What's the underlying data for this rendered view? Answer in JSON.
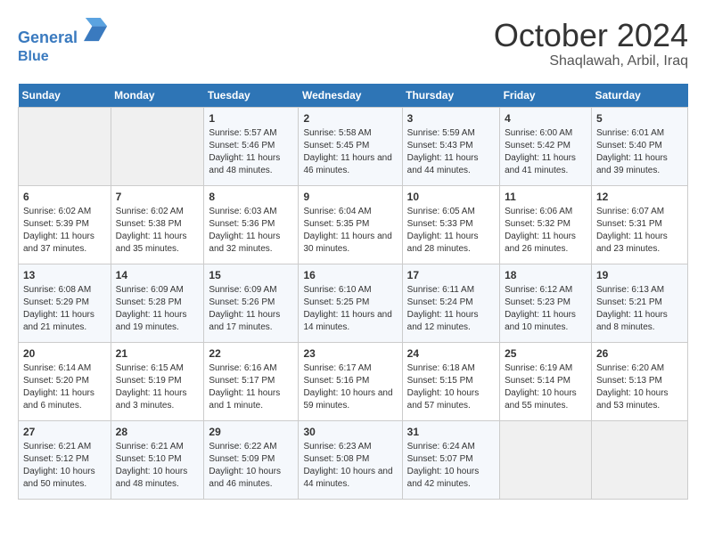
{
  "logo": {
    "line1": "General",
    "line2": "Blue"
  },
  "title": "October 2024",
  "location": "Shaqlawah, Arbil, Iraq",
  "weekdays": [
    "Sunday",
    "Monday",
    "Tuesday",
    "Wednesday",
    "Thursday",
    "Friday",
    "Saturday"
  ],
  "weeks": [
    [
      {
        "day": "",
        "info": ""
      },
      {
        "day": "",
        "info": ""
      },
      {
        "day": "1",
        "info": "Sunrise: 5:57 AM\nSunset: 5:46 PM\nDaylight: 11 hours and 48 minutes."
      },
      {
        "day": "2",
        "info": "Sunrise: 5:58 AM\nSunset: 5:45 PM\nDaylight: 11 hours and 46 minutes."
      },
      {
        "day": "3",
        "info": "Sunrise: 5:59 AM\nSunset: 5:43 PM\nDaylight: 11 hours and 44 minutes."
      },
      {
        "day": "4",
        "info": "Sunrise: 6:00 AM\nSunset: 5:42 PM\nDaylight: 11 hours and 41 minutes."
      },
      {
        "day": "5",
        "info": "Sunrise: 6:01 AM\nSunset: 5:40 PM\nDaylight: 11 hours and 39 minutes."
      }
    ],
    [
      {
        "day": "6",
        "info": "Sunrise: 6:02 AM\nSunset: 5:39 PM\nDaylight: 11 hours and 37 minutes."
      },
      {
        "day": "7",
        "info": "Sunrise: 6:02 AM\nSunset: 5:38 PM\nDaylight: 11 hours and 35 minutes."
      },
      {
        "day": "8",
        "info": "Sunrise: 6:03 AM\nSunset: 5:36 PM\nDaylight: 11 hours and 32 minutes."
      },
      {
        "day": "9",
        "info": "Sunrise: 6:04 AM\nSunset: 5:35 PM\nDaylight: 11 hours and 30 minutes."
      },
      {
        "day": "10",
        "info": "Sunrise: 6:05 AM\nSunset: 5:33 PM\nDaylight: 11 hours and 28 minutes."
      },
      {
        "day": "11",
        "info": "Sunrise: 6:06 AM\nSunset: 5:32 PM\nDaylight: 11 hours and 26 minutes."
      },
      {
        "day": "12",
        "info": "Sunrise: 6:07 AM\nSunset: 5:31 PM\nDaylight: 11 hours and 23 minutes."
      }
    ],
    [
      {
        "day": "13",
        "info": "Sunrise: 6:08 AM\nSunset: 5:29 PM\nDaylight: 11 hours and 21 minutes."
      },
      {
        "day": "14",
        "info": "Sunrise: 6:09 AM\nSunset: 5:28 PM\nDaylight: 11 hours and 19 minutes."
      },
      {
        "day": "15",
        "info": "Sunrise: 6:09 AM\nSunset: 5:26 PM\nDaylight: 11 hours and 17 minutes."
      },
      {
        "day": "16",
        "info": "Sunrise: 6:10 AM\nSunset: 5:25 PM\nDaylight: 11 hours and 14 minutes."
      },
      {
        "day": "17",
        "info": "Sunrise: 6:11 AM\nSunset: 5:24 PM\nDaylight: 11 hours and 12 minutes."
      },
      {
        "day": "18",
        "info": "Sunrise: 6:12 AM\nSunset: 5:23 PM\nDaylight: 11 hours and 10 minutes."
      },
      {
        "day": "19",
        "info": "Sunrise: 6:13 AM\nSunset: 5:21 PM\nDaylight: 11 hours and 8 minutes."
      }
    ],
    [
      {
        "day": "20",
        "info": "Sunrise: 6:14 AM\nSunset: 5:20 PM\nDaylight: 11 hours and 6 minutes."
      },
      {
        "day": "21",
        "info": "Sunrise: 6:15 AM\nSunset: 5:19 PM\nDaylight: 11 hours and 3 minutes."
      },
      {
        "day": "22",
        "info": "Sunrise: 6:16 AM\nSunset: 5:17 PM\nDaylight: 11 hours and 1 minute."
      },
      {
        "day": "23",
        "info": "Sunrise: 6:17 AM\nSunset: 5:16 PM\nDaylight: 10 hours and 59 minutes."
      },
      {
        "day": "24",
        "info": "Sunrise: 6:18 AM\nSunset: 5:15 PM\nDaylight: 10 hours and 57 minutes."
      },
      {
        "day": "25",
        "info": "Sunrise: 6:19 AM\nSunset: 5:14 PM\nDaylight: 10 hours and 55 minutes."
      },
      {
        "day": "26",
        "info": "Sunrise: 6:20 AM\nSunset: 5:13 PM\nDaylight: 10 hours and 53 minutes."
      }
    ],
    [
      {
        "day": "27",
        "info": "Sunrise: 6:21 AM\nSunset: 5:12 PM\nDaylight: 10 hours and 50 minutes."
      },
      {
        "day": "28",
        "info": "Sunrise: 6:21 AM\nSunset: 5:10 PM\nDaylight: 10 hours and 48 minutes."
      },
      {
        "day": "29",
        "info": "Sunrise: 6:22 AM\nSunset: 5:09 PM\nDaylight: 10 hours and 46 minutes."
      },
      {
        "day": "30",
        "info": "Sunrise: 6:23 AM\nSunset: 5:08 PM\nDaylight: 10 hours and 44 minutes."
      },
      {
        "day": "31",
        "info": "Sunrise: 6:24 AM\nSunset: 5:07 PM\nDaylight: 10 hours and 42 minutes."
      },
      {
        "day": "",
        "info": ""
      },
      {
        "day": "",
        "info": ""
      }
    ]
  ]
}
